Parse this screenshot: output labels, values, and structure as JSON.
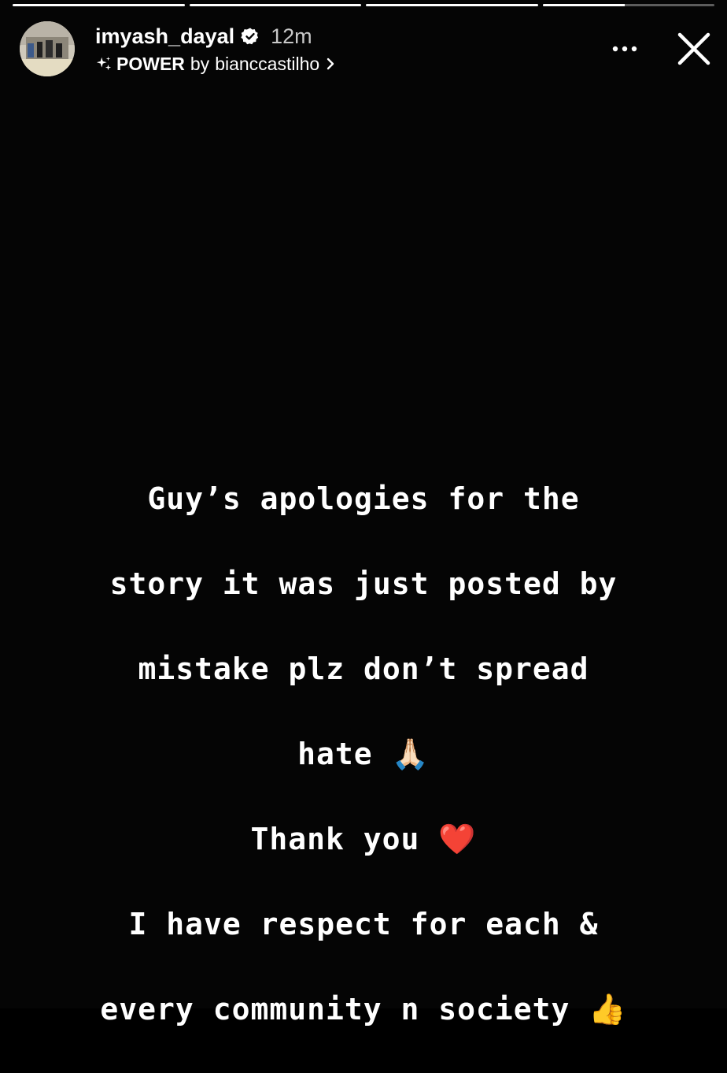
{
  "progress": {
    "segments": [
      1,
      1,
      1,
      0.48
    ]
  },
  "header": {
    "username": "imyash_dayal",
    "time": "12m",
    "verified": true,
    "music": {
      "title": "POWER",
      "by": "by",
      "artist": "bianccastilho",
      "icon": "sparkle-icon"
    }
  },
  "controls": {
    "more_icon": "more-icon",
    "close_icon": "close-icon"
  },
  "story": {
    "lines": [
      "Guy’s apologies for the",
      "story it was just posted by",
      "mistake plz don’t spread",
      "hate 🙏🏻",
      "Thank you ❤️",
      "I have respect for each &",
      "every community n society 👍"
    ]
  },
  "colors": {
    "background": "#050505",
    "text": "#ffffff",
    "verified_badge": "#ffffff",
    "heart": "#e02828",
    "thumbs_up": "#f2b33d"
  }
}
